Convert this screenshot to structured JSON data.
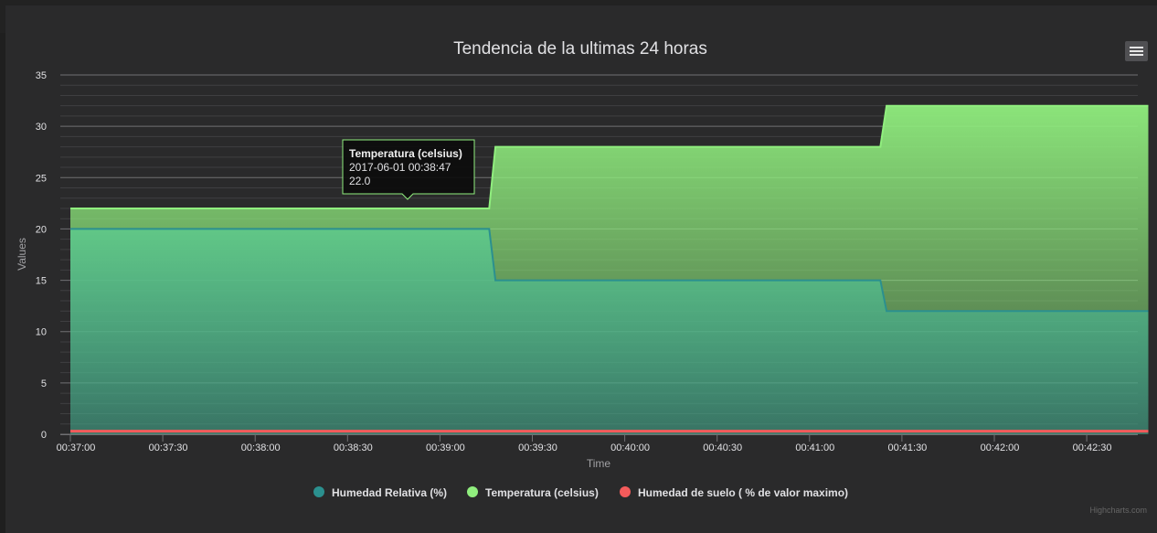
{
  "chart_data": {
    "type": "area",
    "title": "Tendencia de la ultimas 24 horas",
    "xlabel": "Time",
    "ylabel": "Values",
    "ylim": [
      0,
      35
    ],
    "yticks": [
      0,
      5,
      10,
      15,
      20,
      25,
      30,
      35
    ],
    "xlim": [
      "00:37:00",
      "00:42:50"
    ],
    "xticks": [
      "00:37:00",
      "00:37:30",
      "00:38:00",
      "00:38:30",
      "00:39:00",
      "00:39:30",
      "00:40:00",
      "00:40:30",
      "00:41:00",
      "00:41:30",
      "00:42:00",
      "00:42:30"
    ],
    "grid": true,
    "legend_position": "bottom-center",
    "series": [
      {
        "name": "Humedad Relativa (%)",
        "color": "#2b908f",
        "points": [
          [
            "00:37:00",
            20
          ],
          [
            "00:39:16",
            20
          ],
          [
            "00:39:18",
            15
          ],
          [
            "00:41:23",
            15
          ],
          [
            "00:41:25",
            12
          ],
          [
            "00:42:50",
            12
          ]
        ]
      },
      {
        "name": "Temperatura (celsius)",
        "color": "#90ee7e",
        "points": [
          [
            "00:37:00",
            22
          ],
          [
            "00:39:16",
            22
          ],
          [
            "00:39:18",
            28
          ],
          [
            "00:41:23",
            28
          ],
          [
            "00:41:25",
            32
          ],
          [
            "00:42:50",
            32
          ]
        ]
      },
      {
        "name": "Humedad de suelo ( % de valor maximo)",
        "color": "#f45b5b",
        "points": [
          [
            "00:37:00",
            0.3
          ],
          [
            "00:42:50",
            0.3
          ]
        ]
      }
    ],
    "tooltip": {
      "series": "Temperatura (celsius)",
      "time": "2017-06-01 00:38:47",
      "value": "22.0"
    },
    "credits": "Highcharts.com"
  },
  "ui": {
    "menu_icon": "hamburger-menu-icon",
    "background_color": "#2a2a2b"
  }
}
